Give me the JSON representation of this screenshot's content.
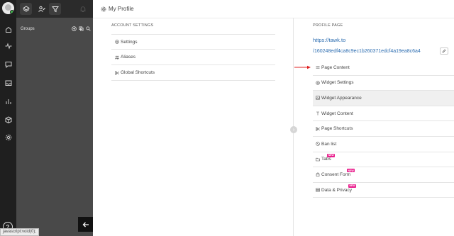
{
  "rail": {
    "icons": [
      "home-icon",
      "activity-icon",
      "chat-icon",
      "inbox-icon",
      "reports-icon",
      "box-icon",
      "settings-icon"
    ],
    "help_label": "?"
  },
  "sidebar": {
    "groups_label": "Groups",
    "status_tip": "javascript:void(0);"
  },
  "header": {
    "page_title": "My Profile"
  },
  "account_settings": {
    "title": "ACCOUNT SETTINGS",
    "items": [
      {
        "label": "Settings",
        "icon": "gear-icon"
      },
      {
        "label": "Aliases",
        "icon": "users-icon"
      },
      {
        "label": "Global Shortcuts",
        "icon": "scissors-icon"
      }
    ]
  },
  "profile_page": {
    "title": "PROFILE PAGE",
    "url_line1": "https://tawk.to",
    "url_line2": "/160248edf4ca8c9ec1b260371edcf4a19ea8c6a4",
    "items": [
      {
        "label": "Page Content",
        "icon": "lines-icon"
      },
      {
        "label": "Widget Settings",
        "icon": "gear-icon"
      },
      {
        "label": "Widget Appearance",
        "icon": "image-icon"
      },
      {
        "label": "Widget Content",
        "icon": "text-icon"
      },
      {
        "label": "Page Shortcuts",
        "icon": "scissors-icon"
      },
      {
        "label": "Ban list",
        "icon": "ban-icon"
      },
      {
        "label": "Tabs",
        "icon": "folder-icon",
        "badge": "NEW"
      },
      {
        "label": "Consent Form",
        "icon": "lock-icon",
        "badge": "NEW"
      },
      {
        "label": "Data & Privacy",
        "icon": "database-icon",
        "badge": "NEW"
      }
    ]
  },
  "colors": {
    "rail_bg": "#1f1f1f",
    "panel_bg": "#494949",
    "link": "#2b6cb0",
    "badge": "#e91e8c",
    "arrow": "#e02020"
  }
}
